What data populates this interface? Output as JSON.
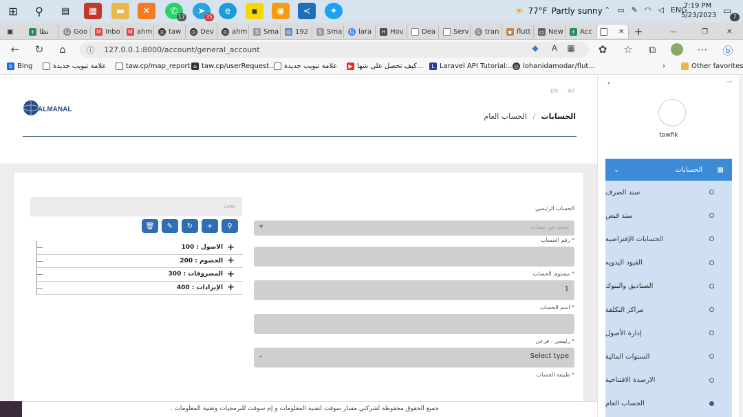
{
  "taskbar": {
    "weather": {
      "temp": "77°F",
      "desc": "Partly sunny"
    },
    "lang": "ENG",
    "time": "7:19 PM",
    "date": "5/23/2023",
    "badges": {
      "whatsapp": "17",
      "telegram": "35",
      "notifications": "7"
    }
  },
  "tabs": [
    {
      "label": "نظا"
    },
    {
      "label": "Goo"
    },
    {
      "label": "Inbo"
    },
    {
      "label": "ahm"
    },
    {
      "label": "taw"
    },
    {
      "label": "Dev"
    },
    {
      "label": "ahm"
    },
    {
      "label": "Sma"
    },
    {
      "label": "192"
    },
    {
      "label": "Sma"
    },
    {
      "label": "lara"
    },
    {
      "label": "Hov"
    },
    {
      "label": "Dea"
    },
    {
      "label": "Serv"
    },
    {
      "label": "tran"
    },
    {
      "label": "flutt"
    },
    {
      "label": "New"
    },
    {
      "label": "Acc"
    }
  ],
  "address": {
    "url": "127.0.0.1:8000/account/general_account"
  },
  "bookmarks": {
    "items": [
      "Bing",
      "علامة تبويب جديدة",
      "taw.cp/map_report",
      "taw.cp/userRequest...",
      "علامة تبويب جديدة",
      "كيف تحصل على شها...",
      "Laravel API Tutorial:...",
      "lohanidamodar/flut..."
    ],
    "other": "Other favorites"
  },
  "page": {
    "lang": [
      "All",
      "EN"
    ],
    "logo_text": "ALMANAL",
    "breadcrumb": {
      "root": "الحسابات",
      "sep": "/",
      "current": "الحساب العام"
    },
    "search_placeholder": "بحث",
    "tree": [
      {
        "label": "الاصول : 100"
      },
      {
        "label": "الخصوم : 200"
      },
      {
        "label": "المصروفات : 300"
      },
      {
        "label": "الإيرادات : 400"
      }
    ],
    "form": {
      "parent_label": "الحساب الرئيسي",
      "parent_placeholder": "ابحث عن حساب",
      "number_label": "رقم الحساب",
      "level_label": "مستوى الحساب",
      "level_value": "1",
      "name_label": "اسم الحساب",
      "type_label": "رئيسي - فرعي",
      "type_value": "Select type",
      "nature_label": "طبيعة الحساب"
    },
    "footer": "جميع الحقوق محفوظة لشركتي مسار سوفت لتقنية المعلومات و إم سوفت للبرمجيات وتقنية المعلومات ."
  },
  "sidebar": {
    "username": "tawfik",
    "menu_title": "الحسابات",
    "items": [
      {
        "label": "سند الصرف"
      },
      {
        "label": "سند قبض"
      },
      {
        "label": "الحسابات الإفتراضية"
      },
      {
        "label": "القيود اليدويه"
      },
      {
        "label": "الصناديق والبنوك"
      },
      {
        "label": "مراكز التكلفة"
      },
      {
        "label": "إدارة الأصول"
      },
      {
        "label": "السنوات المالية"
      },
      {
        "label": "الارصدة الافتتاحية"
      },
      {
        "label": "الحساب العام"
      }
    ]
  },
  "colors": {
    "accent": "#3b8bd9",
    "menu_bg": "#cfe0f3",
    "action_btn": "#2f6db5"
  }
}
